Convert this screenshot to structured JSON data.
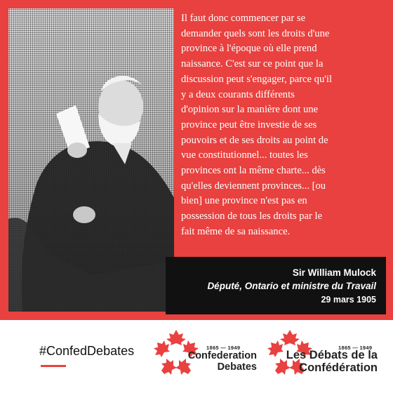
{
  "quote": {
    "text": "Il faut donc commencer par se\ndemander quels sont les droits d'une\nprovince à l'époque où elle prend\nnaissance. C'est sur ce point que la\ndiscussion peut s'engager, parce qu'il\ny a deux courants différents\nd'opinion sur la manière dont une\nprovince peut être investie de ses\npouvoirs et de ses droits au point de\nvue constitutionnel... toutes les\nprovinces ont la même charte... dès\nqu'elles deviennent provinces... [ou\nbien] une province n'est pas en\npossession de tous les droits par le\nfait même de sa naissance."
  },
  "attribution": {
    "name": "Sir William Mulock",
    "role": "Député, Ontario et ministre du Travail",
    "date": "29 mars 1905"
  },
  "hashtag": "#ConfedDebates",
  "logos": {
    "english": {
      "years": "1865 — 1949",
      "line1": "Confederation",
      "line2": "Debates"
    },
    "french": {
      "years": "1865 — 1949",
      "line1": "Les Débats de la",
      "line2": "Confédération"
    }
  },
  "colors": {
    "accent_red": "#e8413f",
    "dark": "#111111",
    "text_light": "#ffffff"
  },
  "icons": {
    "logo_mark": "maple-leaf-ring-icon",
    "photo": "portrait-photo"
  }
}
